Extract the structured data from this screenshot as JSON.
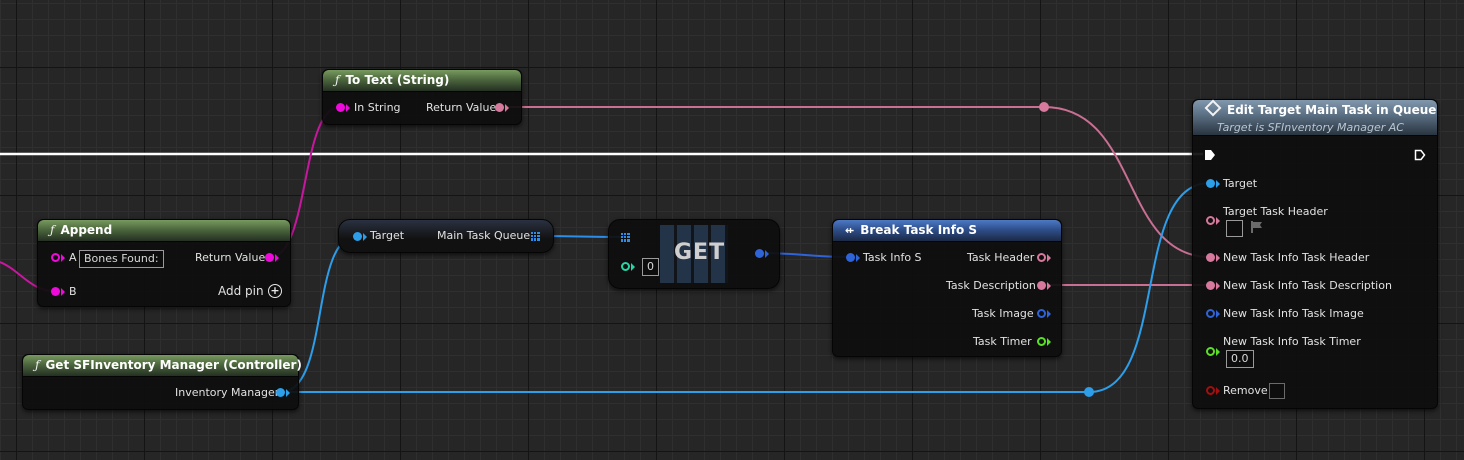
{
  "nodes": {
    "to_text": {
      "title": "To Text (String)",
      "in_label": "In String",
      "out_label": "Return Value"
    },
    "append": {
      "title": "Append",
      "pin_a": "A",
      "pin_a_value": "Bones Found:",
      "pin_b": "B",
      "out_label": "Return Value",
      "add_pin": "Add pin"
    },
    "get_inventory": {
      "title": "Get SFInventory Manager (Controller)",
      "out_label": "Inventory Manager"
    },
    "main_task_queue": {
      "in_label": "Target",
      "out_label": "Main Task Queue"
    },
    "get": {
      "label": "GET",
      "index_value": "0"
    },
    "break_task": {
      "title": "Break Task Info S",
      "in_label": "Task Info S",
      "out_header": "Task Header",
      "out_description": "Task Description",
      "out_image": "Task Image",
      "out_timer": "Task Timer"
    },
    "edit_task": {
      "title": "Edit Target Main Task in Queue",
      "subtitle": "Target is SFInventory Manager AC",
      "target": "Target",
      "target_task_header": "Target Task Header",
      "new_header": "New Task Info Task Header",
      "new_description": "New Task Info Task Description",
      "new_image": "New Task Info Task Image",
      "new_timer": "New Task Info Task Timer",
      "new_timer_value": "0.0",
      "remove": "Remove"
    }
  },
  "colors": {
    "string_pin": "#ee0adb",
    "text_pin": "#d6799c",
    "object_pin": "#2c9eea",
    "struct_pin": "#2f63d8",
    "float_pin": "#5be028",
    "int_pin": "#25d6a5",
    "bool_pin": "#a20f0f",
    "exec_wire": "#ffffff"
  },
  "icons": [
    "function-icon",
    "exec-pin-icon",
    "array-grid-icon",
    "break-struct-icon",
    "edit-diamond-icon",
    "add-circle-icon",
    "flag-icon"
  ]
}
